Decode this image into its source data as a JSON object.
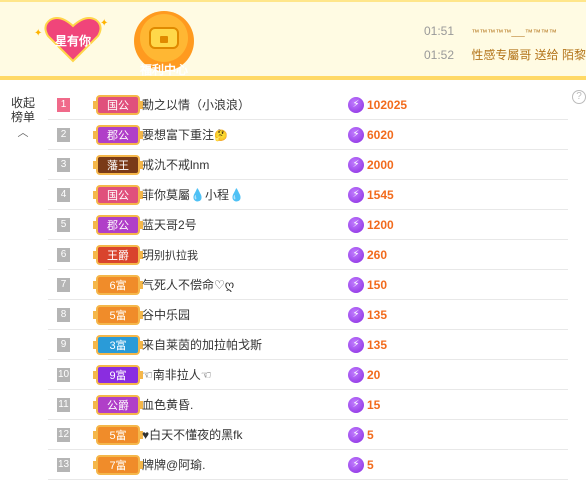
{
  "banner": {
    "star_badge_label": "星有你",
    "welfare_label": "福利中心",
    "colors": {
      "pink": "#f0457a",
      "gold": "#ffb300",
      "banner_bg": "#fffbe3"
    },
    "messages": [
      {
        "time": "01:51",
        "text": "™™™™™___™™™™"
      },
      {
        "time": "01:52",
        "text": "性感专屬哥 送给 陌黎娇"
      }
    ]
  },
  "sidebar": {
    "collapse_label_1": "收起",
    "collapse_label_2": "榜单",
    "chevron": "chevron-up-icon"
  },
  "help_icon": "?",
  "ranking": [
    {
      "rank": "1",
      "badge": "国公",
      "badge_color": "#e0507c",
      "name": "勳之以情（小浪浪）",
      "emoji": "",
      "score": "102025"
    },
    {
      "rank": "2",
      "badge": "郡公",
      "badge_color": "#b03fc8",
      "name": "要想富下重注",
      "emoji": "🤔",
      "score": "6020"
    },
    {
      "rank": "3",
      "badge": "藩王",
      "badge_color": "#7a3a18",
      "name": "戒氿不戒lnm",
      "emoji": "",
      "score": "2000"
    },
    {
      "rank": "4",
      "badge": "国公",
      "badge_color": "#e0507c",
      "name": "菲你莫屬💧小程💧",
      "emoji": "",
      "score": "1545"
    },
    {
      "rank": "5",
      "badge": "郡公",
      "badge_color": "#b03fc8",
      "name": "蓝天哥2号",
      "emoji": "",
      "score": "1200"
    },
    {
      "rank": "6",
      "badge": "王爵",
      "badge_color": "#d9442d",
      "name": "玥",
      "emoji": "别扒拉我",
      "score": "260"
    },
    {
      "rank": "7",
      "badge": "6富",
      "badge_color": "#f08c2a",
      "name": "气死人不偿命♡ღ",
      "emoji": "",
      "score": "150"
    },
    {
      "rank": "8",
      "badge": "5富",
      "badge_color": "#f08c2a",
      "name": "谷中乐园",
      "emoji": "",
      "score": "135"
    },
    {
      "rank": "9",
      "badge": "3富",
      "badge_color": "#2a9bd8",
      "name": "来自莱茵的加拉帕戈斯",
      "emoji": "",
      "score": "135"
    },
    {
      "rank": "10",
      "badge": "9富",
      "badge_color": "#8a2de0",
      "name": "☜南非拉人☜",
      "emoji": "",
      "score": "20"
    },
    {
      "rank": "11",
      "badge": "公爵",
      "badge_color": "#b03fc8",
      "name": "血色黄昏.",
      "emoji": "",
      "score": "15"
    },
    {
      "rank": "12",
      "badge": "5富",
      "badge_color": "#f08c2a",
      "name": "♥白天不懂夜的黑fk",
      "emoji": "",
      "score": "5"
    },
    {
      "rank": "13",
      "badge": "7富",
      "badge_color": "#f08c2a",
      "name": "牌牌@阿瑜.",
      "emoji": "",
      "score": "5"
    }
  ]
}
